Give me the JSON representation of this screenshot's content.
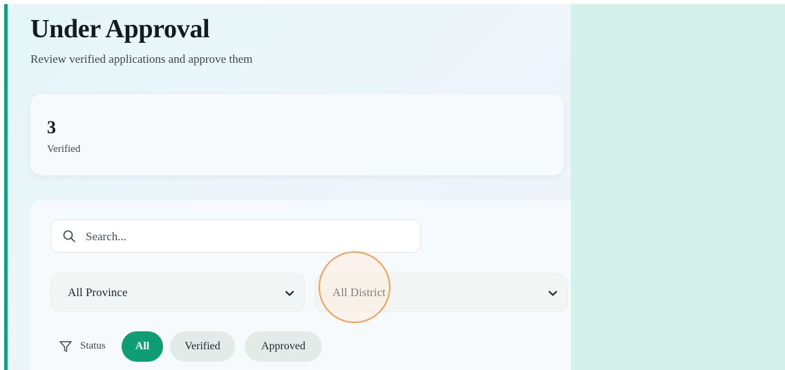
{
  "header": {
    "title": "Under Approval",
    "subtitle": "Review verified applications and approve them"
  },
  "stats": {
    "value": "3",
    "label": "Verified"
  },
  "filters": {
    "search_placeholder": "Search...",
    "province_select": "All Province",
    "district_select": "All District",
    "status_label": "Status",
    "status_options": [
      "All",
      "Verified",
      "Approved"
    ],
    "active_status": "All"
  },
  "icons": {
    "search": "search-icon",
    "chevron": "chevron-down-icon",
    "filter": "funnel-icon"
  },
  "colors": {
    "accent": "#12a07a",
    "active_chip": "#0f9e74",
    "right_panel": "#d4f1ec",
    "click_marker": "#f09e55"
  }
}
